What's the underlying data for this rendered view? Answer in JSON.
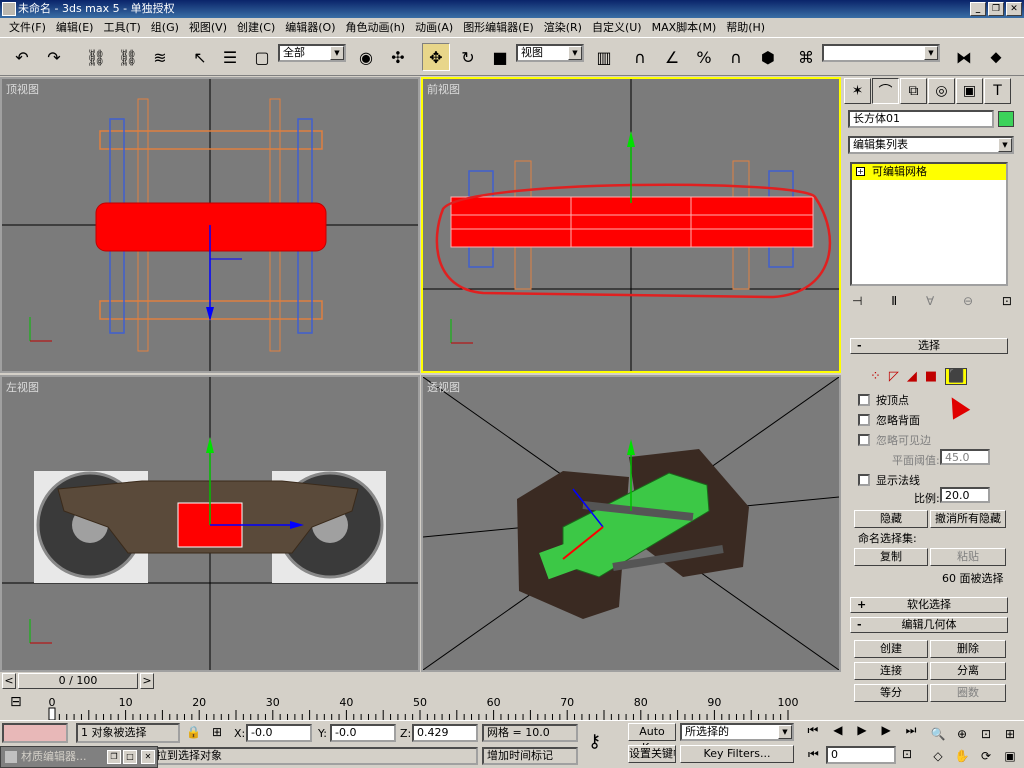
{
  "window": {
    "title": "未命名 - 3ds max 5 - 单独授权",
    "minimize": "_",
    "maximize": "❐",
    "close": "✕"
  },
  "menu": [
    "文件(F)",
    "编辑(E)",
    "工具(T)",
    "组(G)",
    "视图(V)",
    "创建(C)",
    "编辑器(O)",
    "角色动画(h)",
    "动画(A)",
    "图形编辑器(E)",
    "渲染(R)",
    "自定义(U)",
    "MAX脚本(M)",
    "帮助(H)"
  ],
  "toolbar": {
    "selection_filter": "全部",
    "ref_coord": "视图",
    "named_selection": ""
  },
  "viewports": {
    "top": "顶视图",
    "front": "前视图",
    "left": "左视图",
    "perspective": "透视图"
  },
  "command_panel": {
    "object_name": "长方体01",
    "object_color": "#3cd25a",
    "modifier_list": "编辑集列表",
    "stack_item": "可编辑网格",
    "selection": {
      "header": "选择",
      "by_vertex": "按顶点",
      "ignore_backfacing": "忽略背面",
      "ignore_visible_edges": "忽略可见边",
      "planar_thresh_label": "平面阈值:",
      "planar_thresh_value": "45.0",
      "show_normals": "显示法线",
      "scale_label": "比例:",
      "scale_value": "20.0",
      "hide": "隐藏",
      "unhide_all": "撤消所有隐藏",
      "named_sets_label": "命名选择集:",
      "copy": "复制",
      "paste": "粘贴",
      "selected_info": "60 面被选择"
    },
    "soft_selection": "软化选择",
    "edit_geometry": {
      "header": "编辑几何体",
      "create": "创建",
      "delete": "删除",
      "attach": "连接",
      "detach": "分离",
      "divide": "等分",
      "turn": "圈数"
    }
  },
  "timeline": {
    "frame": "0 / 100",
    "ticks": [
      "0",
      "10",
      "20",
      "30",
      "40",
      "50",
      "60",
      "70",
      "80",
      "90",
      "100"
    ]
  },
  "status": {
    "selected": "1 对象被选择",
    "hint": "拖拉到选择对象",
    "x_label": "X:",
    "x_value": "-0.0",
    "y_label": "Y:",
    "y_value": "-0.0",
    "z_label": "Z:",
    "z_value": "0.429",
    "grid": "网格 = 10.0",
    "add_time_tag": "增加时间标记",
    "auto_key": "Auto Key",
    "set_key": "设置关键帧",
    "key_mode": "所选择的",
    "key_filters": "Key Filters...",
    "current_frame": "0",
    "mat_editor": "材质编辑器..."
  }
}
